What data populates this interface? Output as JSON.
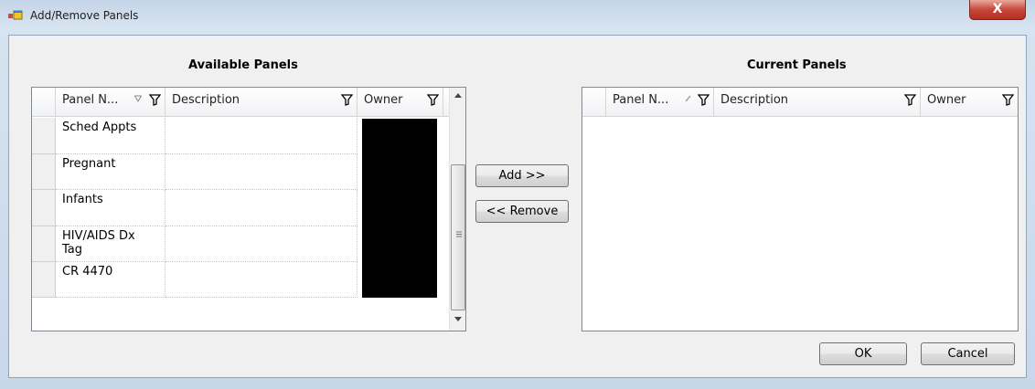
{
  "window": {
    "title": "Add/Remove Panels",
    "close_glyph": "X"
  },
  "available": {
    "title": "Available Panels",
    "columns": [
      "Panel N...",
      "Description",
      "Owner"
    ],
    "rows": [
      {
        "panel": "Sched Appts",
        "description": ""
      },
      {
        "panel": "Pregnant",
        "description": ""
      },
      {
        "panel": "Infants",
        "description": ""
      },
      {
        "panel": "HIV/AIDS Dx Tag",
        "description": ""
      },
      {
        "panel": "CR 4470",
        "description": ""
      }
    ],
    "owner_redacted": true
  },
  "current": {
    "title": "Current Panels",
    "columns": [
      "Panel N...",
      "Description",
      "Owner"
    ],
    "rows": []
  },
  "buttons": {
    "add": "Add >>",
    "remove": "<< Remove",
    "ok": "OK",
    "cancel": "Cancel"
  },
  "icons": {
    "app": "panels-window-icon",
    "filter": "funnel-filter-icon",
    "sort": "sort-indicator-icon"
  }
}
